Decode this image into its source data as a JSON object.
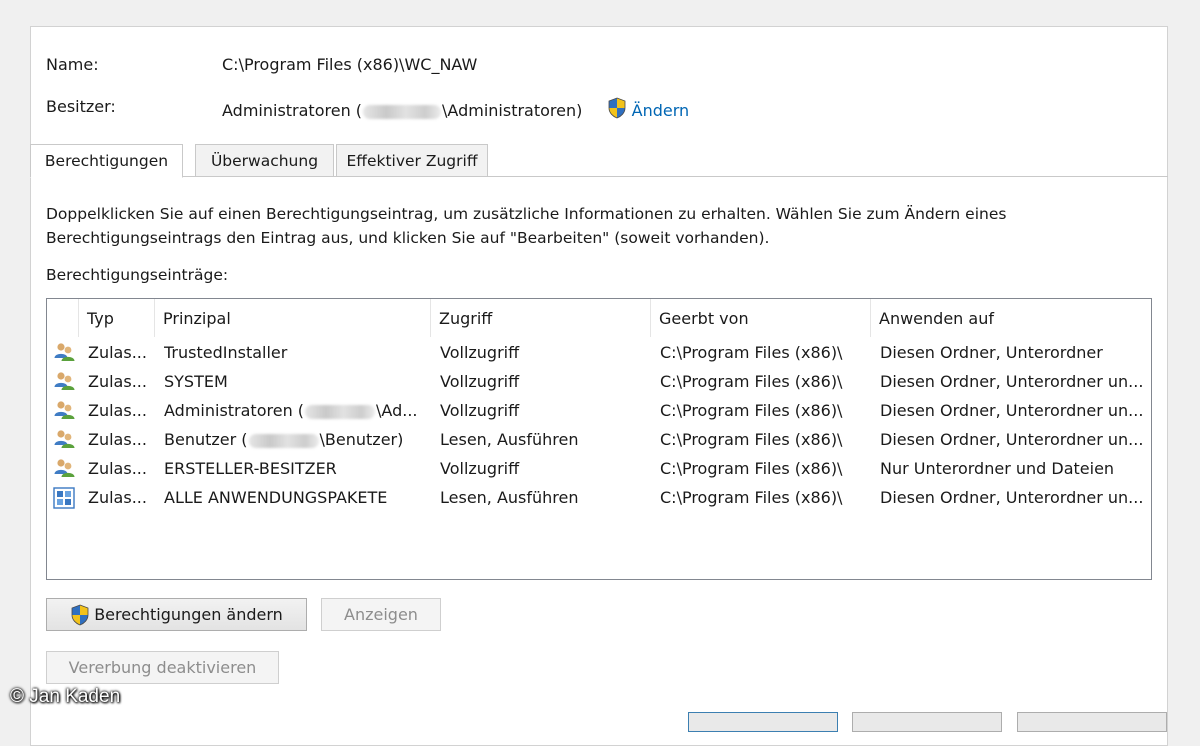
{
  "properties": {
    "name_label": "Name:",
    "name_value": "C:\\Program Files (x86)\\WC_NAW",
    "owner_label": "Besitzer:",
    "owner_prefix": "Administratoren (",
    "owner_suffix": "\\Administratoren)",
    "change_owner_link": "Ändern"
  },
  "tabs": [
    {
      "label": "Berechtigungen",
      "active": true
    },
    {
      "label": "Überwachung",
      "active": false
    },
    {
      "label": "Effektiver Zugriff",
      "active": false
    }
  ],
  "description": "Doppelklicken Sie auf einen Berechtigungseintrag, um zusätzliche Informationen zu erhalten. Wählen Sie zum Ändern eines Berechtigungseintrags den Eintrag aus, und klicken Sie auf \"Bearbeiten\" (soweit vorhanden).",
  "entries_label": "Berechtigungseinträge:",
  "list": {
    "columns": [
      "Typ",
      "Prinzipal",
      "Zugriff",
      "Geerbt von",
      "Anwenden auf"
    ],
    "rows": [
      {
        "icon": "users-icon",
        "type": "Zulas...",
        "principal": "TrustedInstaller",
        "access": "Vollzugriff",
        "inherited": "C:\\Program Files (x86)\\",
        "applies": "Diesen Ordner, Unterordner"
      },
      {
        "icon": "users-icon",
        "type": "Zulas...",
        "principal": "SYSTEM",
        "access": "Vollzugriff",
        "inherited": "C:\\Program Files (x86)\\",
        "applies": "Diesen Ordner, Unterordner un..."
      },
      {
        "icon": "users-icon",
        "type": "Zulas...",
        "principal_prefix": "Administratoren (",
        "principal_suffix": "\\Ad...",
        "access": "Vollzugriff",
        "inherited": "C:\\Program Files (x86)\\",
        "applies": "Diesen Ordner, Unterordner un..."
      },
      {
        "icon": "users-icon",
        "type": "Zulas...",
        "principal_prefix": "Benutzer (",
        "principal_suffix": "\\Benutzer)",
        "access": "Lesen, Ausführen",
        "inherited": "C:\\Program Files (x86)\\",
        "applies": "Diesen Ordner, Unterordner un..."
      },
      {
        "icon": "users-icon",
        "type": "Zulas...",
        "principal": "ERSTELLER-BESITZER",
        "access": "Vollzugriff",
        "inherited": "C:\\Program Files (x86)\\",
        "applies": "Nur Unterordner und Dateien"
      },
      {
        "icon": "app-packages-icon",
        "type": "Zulas...",
        "principal": "ALLE ANWENDUNGSPAKETE",
        "access": "Lesen, Ausführen",
        "inherited": "C:\\Program Files (x86)\\",
        "applies": "Diesen Ordner, Unterordner un..."
      }
    ]
  },
  "buttons": {
    "change_permissions": "Berechtigungen ändern",
    "view": "Anzeigen",
    "disable_inheritance": "Vererbung deaktivieren"
  },
  "watermark": "© Jan Kaden",
  "colors": {
    "link": "#0066b4",
    "shield_blue": "#2f6fc0",
    "shield_yellow": "#f2c21b"
  }
}
